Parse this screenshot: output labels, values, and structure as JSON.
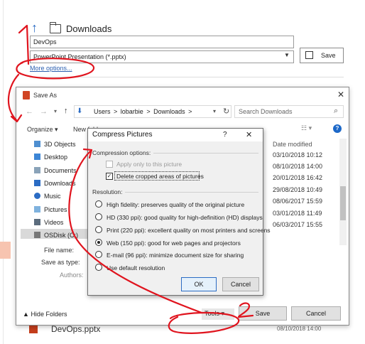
{
  "backstage": {
    "folder": "Downloads",
    "filename_value": "DevOps",
    "filetype_value": "PowerPoint Presentation (*.pptx)",
    "more_options": "More options...",
    "save_label": "Save",
    "bottom_file_name": "DevOps.pptx",
    "bottom_file_date": "08/10/2018 14:00"
  },
  "save_as": {
    "title": "Save As",
    "path": [
      "Users",
      "lobarbie",
      "Downloads"
    ],
    "search_placeholder": "Search Downloads",
    "organize": "Organize ▾",
    "new_folder": "New folder",
    "nav_items": [
      "3D Objects",
      "Desktop",
      "Documents",
      "Downloads",
      "Music",
      "Pictures",
      "Videos",
      "OSDisk (C:)"
    ],
    "date_header": "Date modified",
    "dates": [
      "03/10/2018 10:12",
      "08/10/2018 14:00",
      "20/01/2018 16:42",
      "29/08/2018 10:49",
      "08/06/2017 15:59",
      "03/01/2018 11:49",
      "06/03/2017 15:55"
    ],
    "file_name_label": "File name:",
    "save_type_label": "Save as type:",
    "authors_label": "Authors:",
    "hide_folders": "Hide Folders",
    "tools": "Tools",
    "save": "Save",
    "cancel": "Cancel"
  },
  "compress": {
    "title": "Compress Pictures",
    "help": "?",
    "compression_label": "Compression options:",
    "apply_only": "Apply only to this picture",
    "delete_cropped": "Delete cropped areas of pictures",
    "resolution_label": "Resolution:",
    "options": [
      "High fidelity: preserves quality of the original picture",
      "HD (330 ppi): good quality for high-definition (HD) displays",
      "Print (220 ppi): excellent quality on most printers and screens",
      "Web (150 ppi): good for web pages and projectors",
      "E-mail (96 ppi): minimize document size for sharing",
      "Use default resolution"
    ],
    "selected_index": 3,
    "ok": "OK",
    "cancel": "Cancel"
  },
  "annotations": {
    "marker_1": "1",
    "marker_2": "2",
    "color": "#e0141e"
  }
}
